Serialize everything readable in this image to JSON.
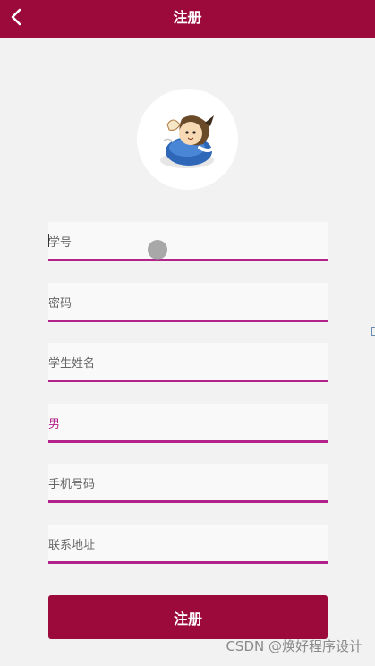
{
  "header": {
    "title": "注册",
    "back_icon": "chevron-left-icon",
    "background_color": "#9c0a3c"
  },
  "avatar": {
    "icon": "cartoon-avatar-image"
  },
  "form": {
    "accent_color": "#b3218a",
    "fields": [
      {
        "placeholder": "学号",
        "value": ""
      },
      {
        "placeholder": "密码",
        "value": ""
      },
      {
        "placeholder": "学生姓名",
        "value": ""
      },
      {
        "placeholder": "男",
        "value": ""
      },
      {
        "placeholder": "手机号码",
        "value": ""
      },
      {
        "placeholder": "联系地址",
        "value": ""
      }
    ],
    "submit_label": "注册"
  },
  "watermark": {
    "text": "CSDN @焕好程序设计"
  }
}
